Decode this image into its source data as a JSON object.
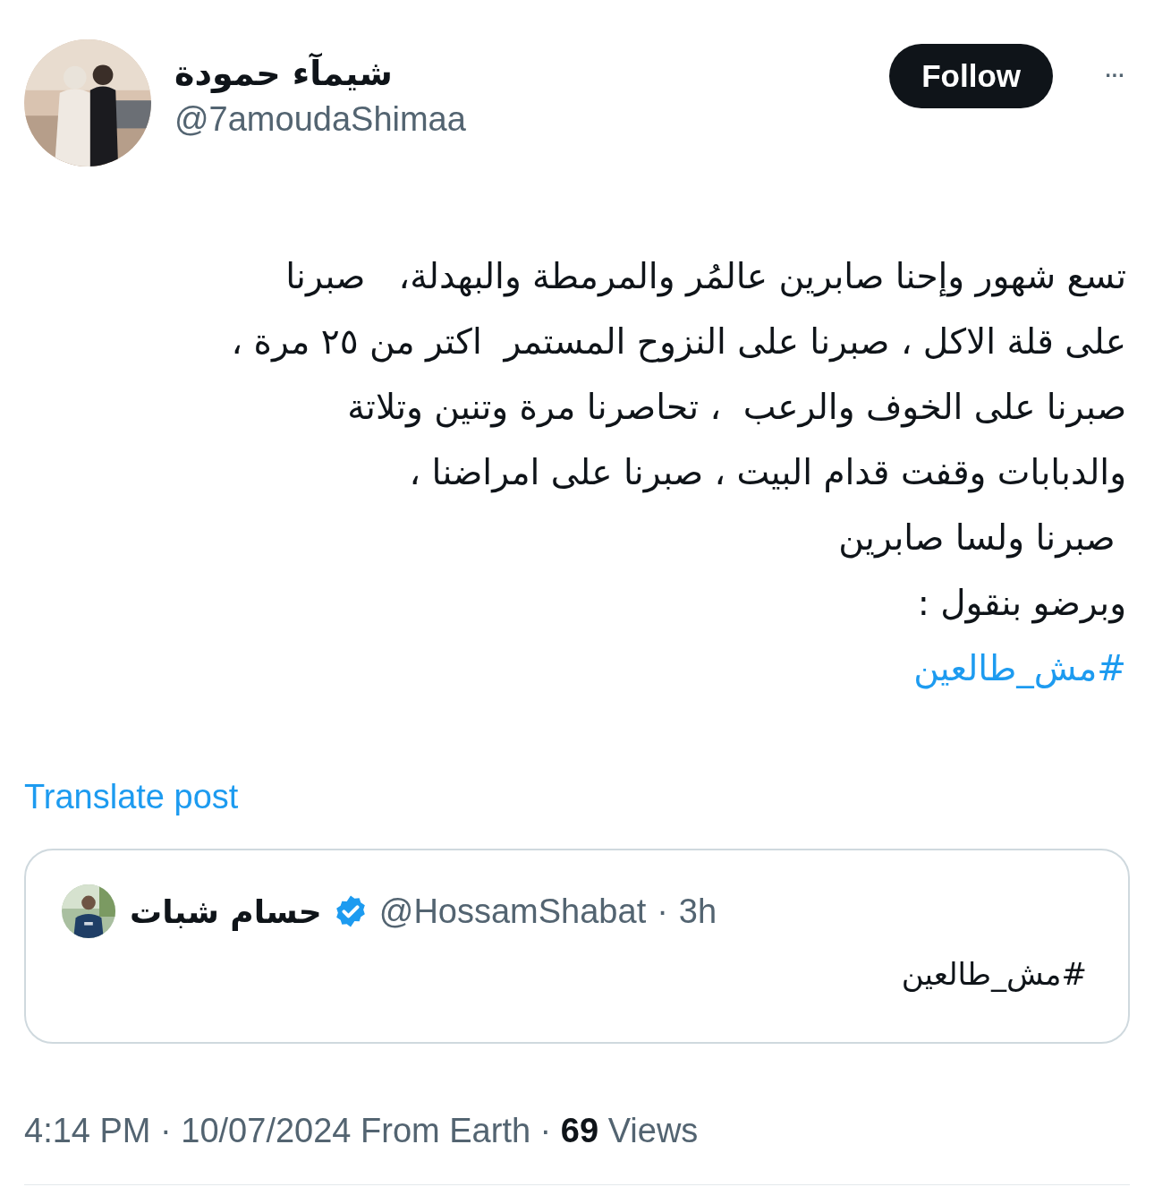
{
  "author": {
    "name": "شيمآء حمودة",
    "handle": "@7amoudaShimaa"
  },
  "follow_button": {
    "label": "Follow"
  },
  "more_button": {
    "label": "···"
  },
  "body": {
    "lines": [
      "تسع شهور وإحنا صابرين عالمُر والمرمطة والبهدلة،   صبرنا",
      "على قلة الاكل ، صبرنا على النزوح المستمر  اكتر من ٢٥ مرة ،",
      "صبرنا على الخوف والرعب  ، تحاصرنا مرة وتنين وتلاتة",
      "والدبابات وقفت قدام البيت ، صبرنا على امراضنا ،",
      " صبرنا ولسا صابرين",
      "وبرضو بنقول :"
    ],
    "hashtag": "#مش_طالعين"
  },
  "translate_link": "Translate post",
  "quoted_post": {
    "name": "حسام شبات",
    "verified": true,
    "handle": "@HossamShabat",
    "separator": "·",
    "time": "3h",
    "text": "#مش_طالعين"
  },
  "footer": "4:14 PM · 10/07/2024 From Earth · **69** Views"
}
